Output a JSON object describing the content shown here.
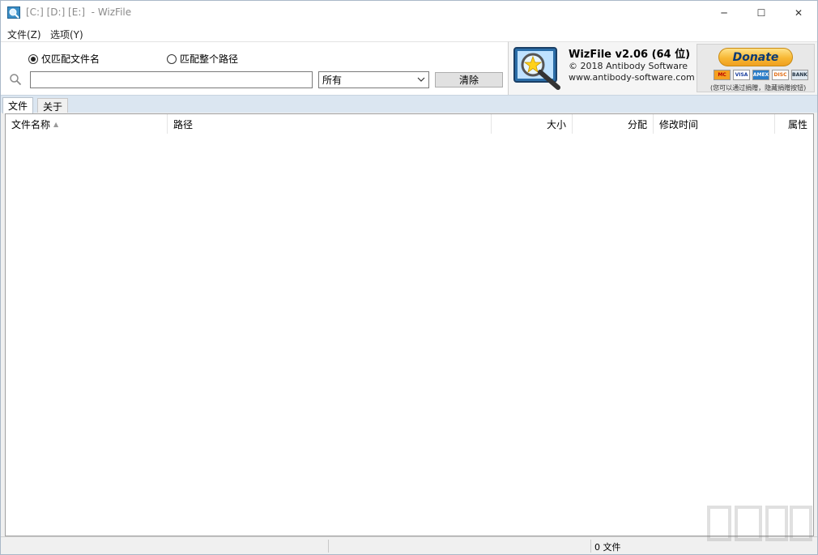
{
  "window": {
    "title": "[C:] [D:] [E:]  - WizFile",
    "minimize_glyph": "─",
    "maximize_glyph": "☐",
    "close_glyph": "✕"
  },
  "menu": {
    "items": [
      {
        "label": "文件(Z)"
      },
      {
        "label": "选项(Y)"
      }
    ]
  },
  "search": {
    "radio_filename": "仅匹配文件名",
    "radio_fullpath": "匹配整个路径",
    "radio_selected": "filename",
    "input_value": "",
    "filter_value": "所有",
    "clear_label": "清除"
  },
  "about_panel": {
    "product": "WizFile v2.06 (64 位)",
    "copyright": "© 2018 Antibody Software",
    "website": "www.antibody-software.com",
    "donate_label": "Donate",
    "cards": [
      "MC",
      "VISA",
      "AMEX",
      "DISC",
      "BANK"
    ],
    "donate_note": "(您可以通过捐赠，隐藏捐赠按钮)"
  },
  "tabs": [
    {
      "label": "文件",
      "active": true
    },
    {
      "label": "关于",
      "active": false
    }
  ],
  "list": {
    "columns": [
      "文件名称",
      "路径",
      "大小",
      "分配",
      "修改时间",
      "属性"
    ],
    "rows": []
  },
  "status": {
    "count_text": "0 文件"
  },
  "colors": {
    "accent_tab_bar": "#dbe6f1",
    "donate_text": "#0b3a75"
  }
}
